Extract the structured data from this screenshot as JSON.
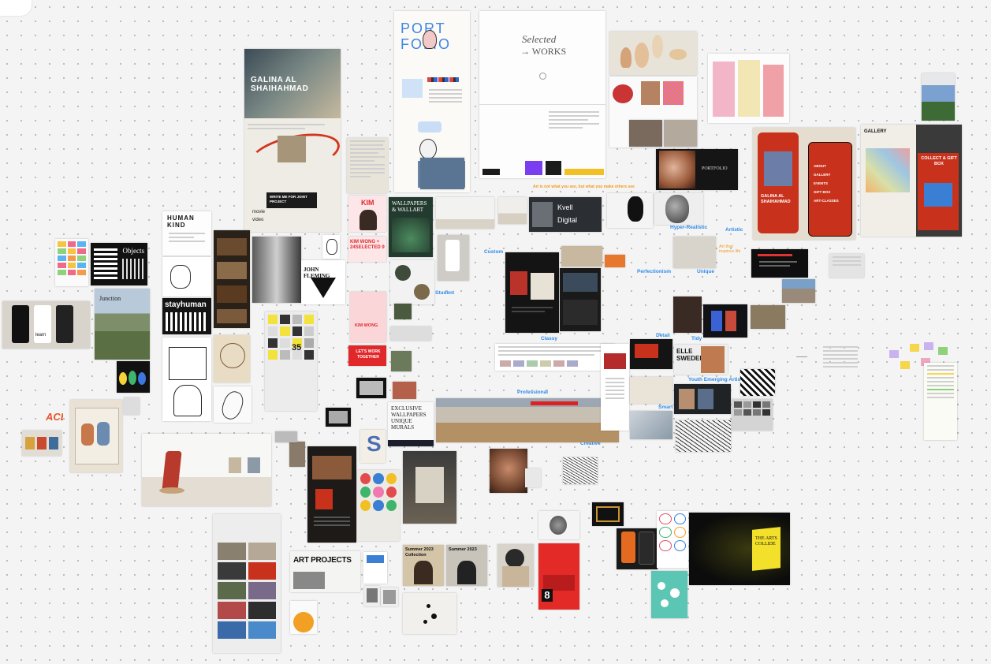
{
  "cards": {
    "galina_title": "GALINA AL SHAIHAHMAD",
    "galina_write": "WRITE ME FOR JOINT PROJECT",
    "galina_movie": "movie",
    "galina_video": "video",
    "portfolio_title_top": "PORT",
    "portfolio_title_bottom": "FOLIO",
    "selected_line1": "Selected",
    "selected_line2": "→ WORKS",
    "gallery_word": "GALLERY",
    "collect_gift": "COLLECT & GIFT BOX",
    "phone_name": "GALINA AL SHAIHAHMAD",
    "phone_menu": [
      "ABOUT",
      "GALLERY",
      "EVENTS",
      "GIFT BOX",
      "ART-CLASSES"
    ],
    "human_kind": "HUMAN KIND",
    "objects": "Objects",
    "stayhuman": "stayhuman",
    "john_fleming": "JOHN FLEMING",
    "kim": "KIM",
    "kim_wong": "KIM WONG + 24SELECTED 9",
    "kim_wong_small": "KIM WONG",
    "lets_work": "LET'S WORK TOGETHER",
    "wallpapers": "WALLPAPERS & WALLART",
    "exclusive": "EXCLUSIVE WALLPAPERS UNIQUE MURALS",
    "art_projects": "ART PROJECTS",
    "the_arts_collide": "THE ARTS COLLIDE",
    "ace": "ACE",
    "elle_sweden": "ELLE SWEDEN",
    "kvell": "Kvell",
    "digital": "Digital",
    "summer": "Summer 2023",
    "collection": "Collection",
    "number_eight": "8",
    "number_35": "35",
    "s_letter": "S",
    "learn": "learn"
  },
  "tags": {
    "art_not_what": "Art is not what you see, but what you make others see",
    "hyper_realistic": "Hyper-Realistic",
    "artistic": "Artistic",
    "art_that_inspires": "Art that inspires life",
    "perfectionism": "Perfectionism",
    "unique": "Unique",
    "custom": "Custom",
    "student": "Student",
    "classy": "Classy",
    "detail": "Detail",
    "tidy": "Tidy",
    "professional": "Professional",
    "youth_emerging": "Youth Emerging Artist",
    "smart": "Smart",
    "creative": "Creative"
  },
  "colors": {
    "canvas": "#f4f4f4",
    "tag_blue": "#2f8ce8",
    "tag_orange": "#f29a1d",
    "gallery_red": "#c8321c"
  }
}
